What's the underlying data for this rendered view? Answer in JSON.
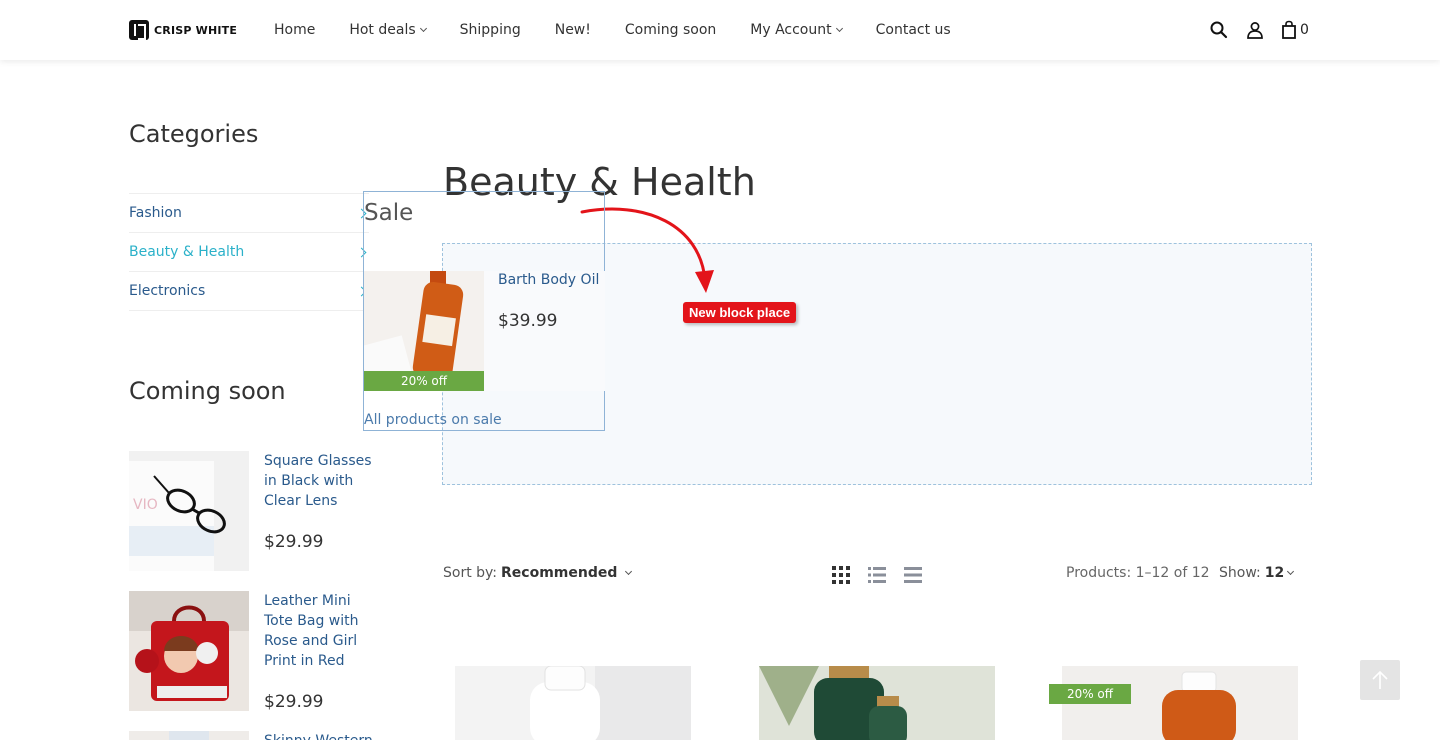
{
  "header": {
    "logo_text": "CRISP WHITE",
    "nav": [
      {
        "label": "Home",
        "dropdown": false
      },
      {
        "label": "Hot deals",
        "dropdown": true
      },
      {
        "label": "Shipping",
        "dropdown": false
      },
      {
        "label": "New!",
        "dropdown": false
      },
      {
        "label": "Coming soon",
        "dropdown": false
      },
      {
        "label": "My Account",
        "dropdown": true
      },
      {
        "label": "Contact us",
        "dropdown": false
      }
    ],
    "cart_count": "0"
  },
  "sidebar": {
    "categories_title": "Categories",
    "categories": [
      {
        "label": "Fashion",
        "active": false
      },
      {
        "label": "Beauty & Health",
        "active": true
      },
      {
        "label": "Electronics",
        "active": false
      }
    ],
    "coming_soon_title": "Coming soon",
    "coming_soon": [
      {
        "name": "Square Glasses in Black with Clear Lens",
        "price": "$29.99"
      },
      {
        "name": "Leather Mini Tote Bag with Rose and Girl Print in Red",
        "price": "$29.99"
      },
      {
        "name": "Skinny Western",
        "price": ""
      }
    ]
  },
  "sale": {
    "title": "Sale",
    "product_name": "Barth Body Oil",
    "price": "$39.99",
    "badge": "20% off",
    "all_link": "All products on sale"
  },
  "main": {
    "title": "Beauty & Health",
    "new_block_label": "New block place",
    "sort_label": "Sort by:",
    "sort_value": "Recommended",
    "products_count": "Products: 1–12 of 12",
    "show_label": "Show:",
    "show_value": "12",
    "card_badge": "20% off"
  },
  "colors": {
    "accent": "#2bb1c9",
    "link": "#2a5a8c",
    "badge_green": "#6aa843",
    "annotation_red": "#e3141a"
  }
}
